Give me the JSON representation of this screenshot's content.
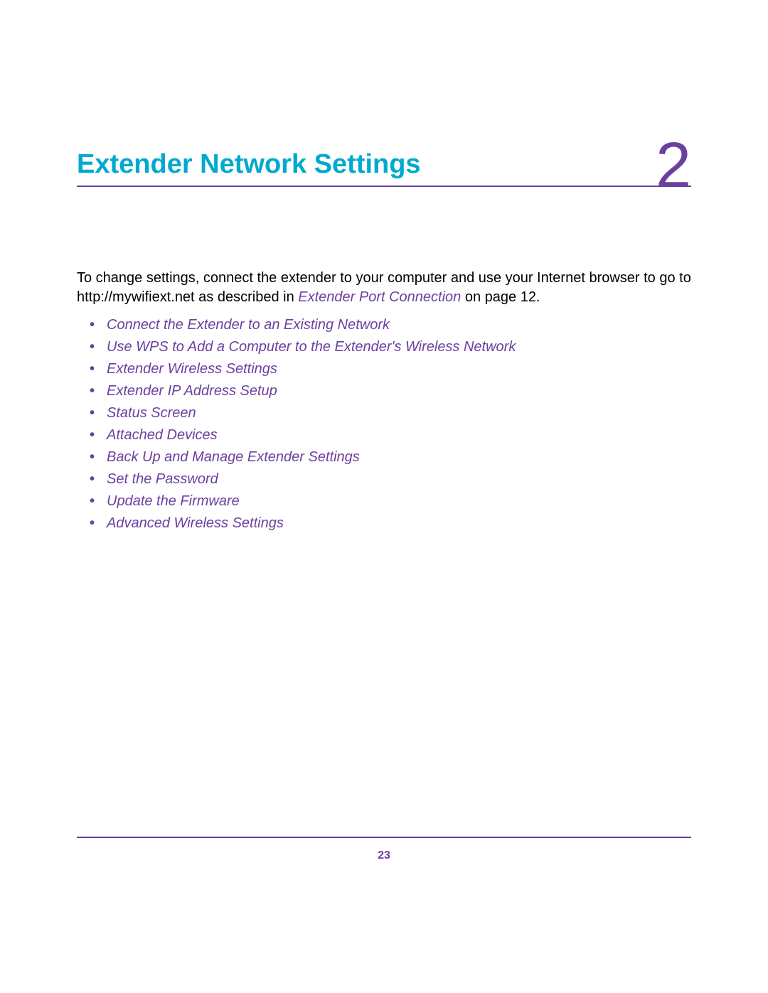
{
  "chapter": {
    "title": "Extender Network Settings",
    "number": "2"
  },
  "intro": {
    "text_before_link": "To change settings, connect the extender to your computer and use your Internet browser to go to http://mywifiext.net as described in ",
    "link_text": "Extender Port Connection",
    "text_after_link": " on page 12."
  },
  "toc_items": [
    "Connect the Extender to an Existing Network",
    "Use WPS to Add a Computer to the Extender's Wireless Network",
    "Extender Wireless Settings",
    "Extender IP Address Setup",
    "Status Screen",
    "Attached Devices",
    "Back Up and Manage Extender Settings",
    "Set the Password",
    "Update the Firmware",
    "Advanced Wireless Settings"
  ],
  "page_number": "23"
}
